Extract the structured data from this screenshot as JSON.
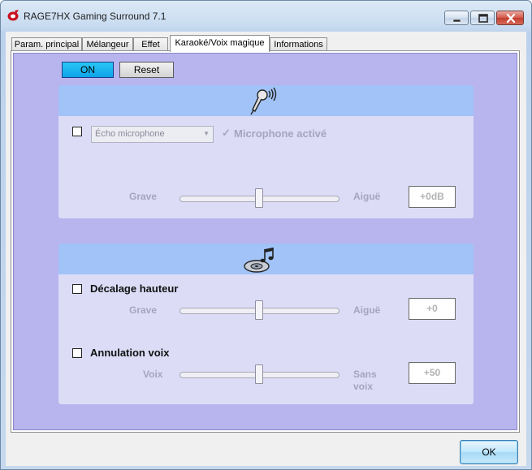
{
  "window": {
    "title": "RAGE7HX Gaming Surround 7.1"
  },
  "tabs": [
    {
      "label": "Param. principal"
    },
    {
      "label": "Mélangeur"
    },
    {
      "label": "Effet"
    },
    {
      "label": "Karaoké/Voix magique",
      "active": true
    },
    {
      "label": "Informations"
    }
  ],
  "toolbar": {
    "on_label": "ON",
    "reset_label": "Reset"
  },
  "karaoke": {
    "echo_select": "Écho microphone",
    "mic_active_label": "Microphone activé",
    "slider_left": "Grave",
    "slider_right": "Aiguë",
    "slider_level": 0.5,
    "value": "+0dB"
  },
  "voice": {
    "pitch": {
      "label": "Décalage hauteur",
      "slider_left": "Grave",
      "slider_right": "Aiguë",
      "slider_level": 0.5,
      "value": "+0"
    },
    "cancel": {
      "label": "Annulation voix",
      "slider_left": "Voix",
      "slider_right_line1": "Sans",
      "slider_right_line2": "voix",
      "slider_level": 0.5,
      "value": "+50"
    }
  },
  "footer": {
    "ok_label": "OK"
  },
  "colors": {
    "panel": "#b7b4ee",
    "card": "#dcdcf7",
    "card_header": "#a1c3f7",
    "on_button": "#1aaef0"
  },
  "icons": {
    "karaoke": "microphone-icon",
    "voice": "music-disc-icon"
  }
}
